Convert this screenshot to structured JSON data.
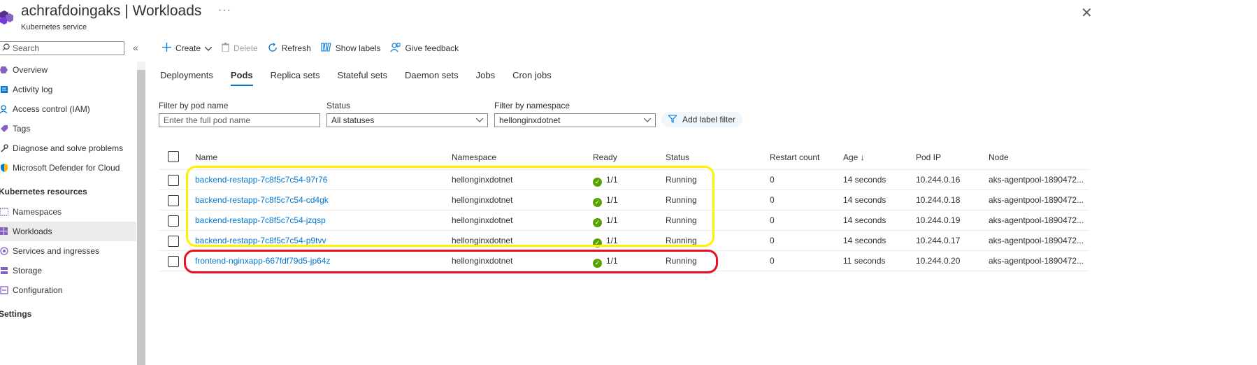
{
  "header": {
    "title": "achrafdoingaks | Workloads",
    "subtitle": "Kubernetes service",
    "more": "···",
    "close": "✕"
  },
  "sidebar": {
    "search_placeholder": "Search",
    "collapse": "«",
    "items": [
      {
        "label": "Overview",
        "icon": "overview-icon"
      },
      {
        "label": "Activity log",
        "icon": "activity-log-icon"
      },
      {
        "label": "Access control (IAM)",
        "icon": "iam-icon"
      },
      {
        "label": "Tags",
        "icon": "tag-icon"
      },
      {
        "label": "Diagnose and solve problems",
        "icon": "wrench-icon"
      },
      {
        "label": "Microsoft Defender for Cloud",
        "icon": "shield-icon"
      }
    ],
    "section_k8s": "Kubernetes resources",
    "k8s_items": [
      {
        "label": "Namespaces",
        "icon": "namespaces-icon"
      },
      {
        "label": "Workloads",
        "icon": "workloads-icon",
        "active": true
      },
      {
        "label": "Services and ingresses",
        "icon": "services-icon"
      },
      {
        "label": "Storage",
        "icon": "storage-icon"
      },
      {
        "label": "Configuration",
        "icon": "configuration-icon"
      }
    ],
    "section_settings": "Settings"
  },
  "toolbar": {
    "create": "Create",
    "delete": "Delete",
    "refresh": "Refresh",
    "show_labels": "Show labels",
    "feedback": "Give feedback"
  },
  "tabs": [
    "Deployments",
    "Pods",
    "Replica sets",
    "Stateful sets",
    "Daemon sets",
    "Jobs",
    "Cron jobs"
  ],
  "active_tab": "Pods",
  "filters": {
    "pod_name_label": "Filter by pod name",
    "pod_name_placeholder": "Enter the full pod name",
    "status_label": "Status",
    "status_value": "All statuses",
    "namespace_label": "Filter by namespace",
    "namespace_value": "hellonginxdotnet",
    "add_label_filter": "Add label filter"
  },
  "table": {
    "headers": {
      "name": "Name",
      "namespace": "Namespace",
      "ready": "Ready",
      "status": "Status",
      "restart": "Restart count",
      "age": "Age ↓",
      "pod_ip": "Pod IP",
      "node": "Node"
    },
    "rows": [
      {
        "name": "backend-restapp-7c8f5c7c54-97r76",
        "namespace": "hellonginxdotnet",
        "ready": "1/1",
        "status": "Running",
        "restart": "0",
        "age": "14 seconds",
        "ip": "10.244.0.16",
        "node": "aks-agentpool-1890472..."
      },
      {
        "name": "backend-restapp-7c8f5c7c54-cd4gk",
        "namespace": "hellonginxdotnet",
        "ready": "1/1",
        "status": "Running",
        "restart": "0",
        "age": "14 seconds",
        "ip": "10.244.0.18",
        "node": "aks-agentpool-1890472..."
      },
      {
        "name": "backend-restapp-7c8f5c7c54-jzqsp",
        "namespace": "hellonginxdotnet",
        "ready": "1/1",
        "status": "Running",
        "restart": "0",
        "age": "14 seconds",
        "ip": "10.244.0.19",
        "node": "aks-agentpool-1890472..."
      },
      {
        "name": "backend-restapp-7c8f5c7c54-p9tvv",
        "namespace": "hellonginxdotnet",
        "ready": "1/1",
        "status": "Running",
        "restart": "0",
        "age": "14 seconds",
        "ip": "10.244.0.17",
        "node": "aks-agentpool-1890472..."
      },
      {
        "name": "frontend-nginxapp-667fdf79d5-jp64z",
        "namespace": "hellonginxdotnet",
        "ready": "1/1",
        "status": "Running",
        "restart": "0",
        "age": "11 seconds",
        "ip": "10.244.0.20",
        "node": "aks-agentpool-1890472..."
      }
    ]
  },
  "colors": {
    "accent": "#0078d4",
    "highlight_backend": "#fff200",
    "highlight_frontend": "#e81123",
    "ready_ok": "#57a300"
  }
}
